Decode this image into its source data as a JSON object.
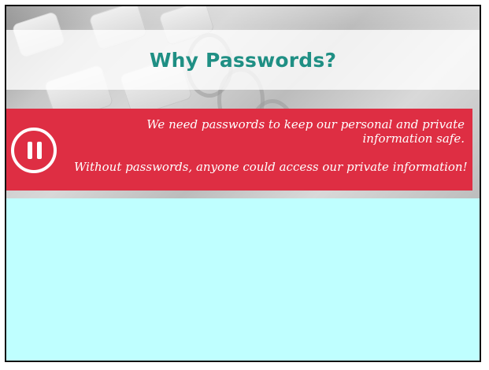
{
  "slide": {
    "title": "Why Passwords?",
    "info": {
      "line_1": "We need passwords to keep our personal and private information safe.",
      "line_2": "Without passwords, anyone could access our private information!"
    },
    "icons": {
      "pause": "pause-icon"
    },
    "colors": {
      "title": "#1f8f84",
      "info_box": "#de2e43",
      "lower_area": "#bfffff",
      "text_on_red": "#ffffff"
    }
  }
}
